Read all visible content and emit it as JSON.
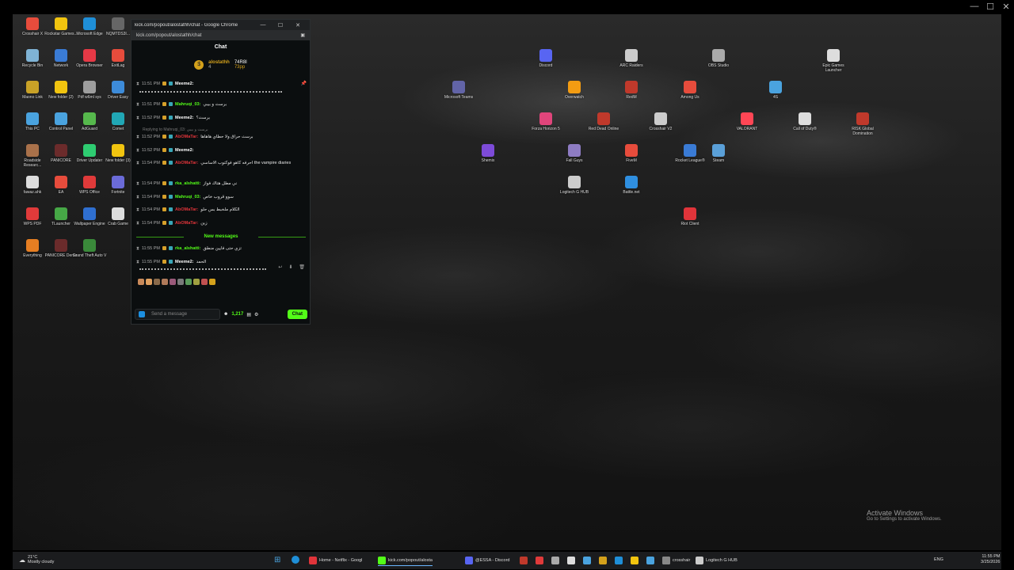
{
  "desktop_icons": [
    {
      "label": "Crosshair X",
      "color": "#e74c3c"
    },
    {
      "label": "Rockstar Games...",
      "color": "#f1c40f"
    },
    {
      "label": "Microsoft Edge",
      "color": "#1f8fd8"
    },
    {
      "label": "NQMTDS3I...",
      "color": "#666666"
    },
    {
      "label": "Recycle Bin",
      "color": "#7fb3d5"
    },
    {
      "label": "Network",
      "color": "#3a7bd5"
    },
    {
      "label": "Opera Browser",
      "color": "#e63946"
    },
    {
      "label": "ExitLag",
      "color": "#e74c3c"
    },
    {
      "label": "Maono Link",
      "color": "#c9a227"
    },
    {
      "label": "New folder (2)",
      "color": "#f1c40f"
    },
    {
      "label": "Pdf w6ml sys",
      "color": "#9e9e9e"
    },
    {
      "label": "Driver Easy",
      "color": "#3d8bd9"
    },
    {
      "label": "This PC",
      "color": "#4aa3df"
    },
    {
      "label": "Control Panel",
      "color": "#4aa3df"
    },
    {
      "label": "AdGuard",
      "color": "#56b84c"
    },
    {
      "label": "Comet",
      "color": "#21a7b5"
    },
    {
      "label": "Roadside Researc...",
      "color": "#a9714a"
    },
    {
      "label": "PANICORE",
      "color": "#6b2b2b"
    },
    {
      "label": "Driver Updater",
      "color": "#2ecc71"
    },
    {
      "label": "New folder (3)",
      "color": "#f1c40f"
    },
    {
      "label": "fawaz.ahk",
      "color": "#dddddd"
    },
    {
      "label": "EA",
      "color": "#e74c3c"
    },
    {
      "label": "WPS Office",
      "color": "#e03a3a"
    },
    {
      "label": "Fortnite",
      "color": "#6b6bd8"
    },
    {
      "label": "WPS PDF",
      "color": "#e03a3a"
    },
    {
      "label": "TLauncher",
      "color": "#46a846"
    },
    {
      "label": "Wallpaper Engine",
      "color": "#2f6fd0"
    },
    {
      "label": "Crab Game",
      "color": "#dddddd"
    },
    {
      "label": "Everything",
      "color": "#e67e22"
    },
    {
      "label": "PANICORE Demo",
      "color": "#6b2b2b"
    },
    {
      "label": "Grand Theft Auto V",
      "color": "#3a8a3a"
    },
    {
      "label": "Discord",
      "color": "#5865f2"
    },
    {
      "label": "ARC Raiders",
      "color": "#cccccc"
    },
    {
      "label": "OBS Studio",
      "color": "#aaaaaa"
    },
    {
      "label": "Epic Games Launcher",
      "color": "#dddddd"
    },
    {
      "label": "Microsoft Teams",
      "color": "#6264a7"
    },
    {
      "label": "Overwatch",
      "color": "#f39c12"
    },
    {
      "label": "RedM",
      "color": "#c0392b"
    },
    {
      "label": "Among Us",
      "color": "#e74c3c"
    },
    {
      "label": "4S",
      "color": "#4aa3df"
    },
    {
      "label": "Forza Horizon 5",
      "color": "#e0457b"
    },
    {
      "label": "Red Dead Online",
      "color": "#c0392b"
    },
    {
      "label": "Crosshair V2",
      "color": "#cccccc"
    },
    {
      "label": "VALORANT",
      "color": "#ff4655"
    },
    {
      "label": "Call of Duty®",
      "color": "#dddddd"
    },
    {
      "label": "RISK Global Domination",
      "color": "#c0392b"
    },
    {
      "label": "Shemix",
      "color": "#7d4bd8"
    },
    {
      "label": "Fall Guys",
      "color": "#8e7cc3"
    },
    {
      "label": "FiveM",
      "color": "#e74c3c"
    },
    {
      "label": "Rocket League®",
      "color": "#3a7bd5"
    },
    {
      "label": "Steam",
      "color": "#5aa0d8"
    },
    {
      "label": "Logitech G HUB",
      "color": "#cccccc"
    },
    {
      "label": "Battle.net",
      "color": "#2f8fe0"
    },
    {
      "label": "Riot Client",
      "color": "#e0343a"
    }
  ],
  "window": {
    "title": "kick.com/popout/alostathh/chat - Google Chrome",
    "url": "kick.com/popout/alostathh/chat",
    "chat_header": "Chat"
  },
  "pinned": {
    "username": "alostathh",
    "level": "4",
    "stat1": "74R8I",
    "stat2": "73pp"
  },
  "messages": [
    {
      "time": "11:51 PM",
      "user": "Meeme2:",
      "user_color": "#ffffff",
      "text": ""
    },
    {
      "time": "11:51 PM",
      "user": "Mahruqi_03:",
      "user_color": "#53fc18",
      "text": "برسث و بيبي"
    },
    {
      "time": "11:52 PM",
      "user": "Meeme2:",
      "user_color": "#ffffff",
      "text": "برسث؟"
    },
    {
      "time": "11:52 PM",
      "user": "AbOMaTar:",
      "user_color": "#e0343a",
      "text": "برسث حراق ولا حطاي هاهاها"
    },
    {
      "time": "11:52 PM",
      "user": "Meeme2:",
      "user_color": "#ffffff",
      "text": ""
    },
    {
      "time": "11:54 PM",
      "user": "AbOMaTar:",
      "user_color": "#e0343a",
      "text": "احرفه كاهو فوكتوب الاساسي the vampire diaries"
    },
    {
      "time": "11:54 PM",
      "user": "rka_alshatti:",
      "user_color": "#53fc18",
      "text": "ني مطل هتاك فواز"
    },
    {
      "time": "11:54 PM",
      "user": "Mahruqi_03:",
      "user_color": "#53fc18",
      "text": "سوو قروب خاص"
    },
    {
      "time": "11:54 PM",
      "user": "AbOMaTar:",
      "user_color": "#e0343a",
      "text": "الكلام ملخبط بس حلو"
    },
    {
      "time": "11:54 PM",
      "user": "AbOMaTar:",
      "user_color": "#e0343a",
      "text": "زين"
    },
    {
      "time": "11:55 PM",
      "user": "rka_alshatti:",
      "user_color": "#53fc18",
      "text": "تزي حتى فايين منطق"
    },
    {
      "time": "11:55 PM",
      "user": "Meeme2:",
      "user_color": "#ffffff",
      "text": "الحمد"
    }
  ],
  "reply_note": "Replying to Mahruqi_03: برسث و بيبي",
  "new_messages_label": "New messages",
  "composer": {
    "placeholder": "Send a message",
    "points": "1,217",
    "chat_button": "Chat"
  },
  "taskbar": {
    "weather_temp": "21°C",
    "weather_desc": "Mostly cloudy",
    "apps": [
      {
        "label": "Home - Netflix - Googl",
        "color": "#e0343a"
      },
      {
        "label": "kick.com/popout/alosta",
        "color": "#53fc18"
      },
      {
        "label": "@ESSA - Discord",
        "color": "#5865f2"
      },
      {
        "label": "crosshair",
        "color": "#cccccc"
      },
      {
        "label": "Logitech G HUB",
        "color": "#cccccc"
      }
    ],
    "lang": "ENG",
    "time": "11:55 PM",
    "date": "3/25/2026"
  },
  "activate": {
    "line1": "Activate Windows",
    "line2": "Go to Settings to activate Windows."
  }
}
